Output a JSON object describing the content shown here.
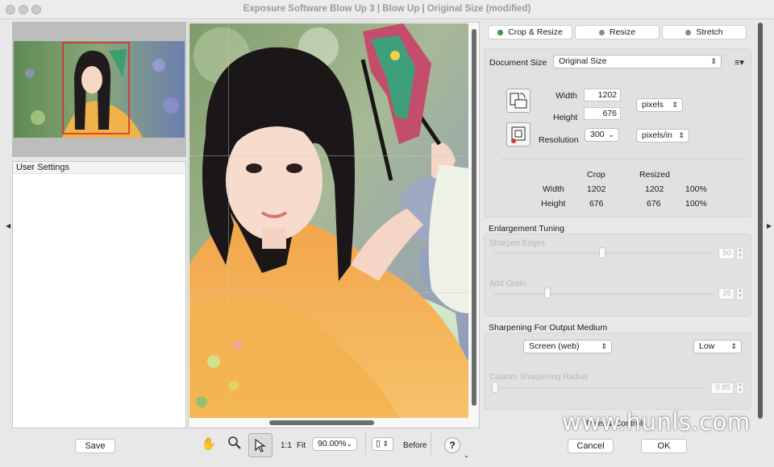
{
  "window": {
    "title": "Exposure Software Blow Up 3 | Blow Up | Original Size (modified)"
  },
  "left_panel": {
    "settings_header": "User Settings",
    "save_label": "Save"
  },
  "tabs": [
    {
      "label": "Crop & Resize",
      "icon": "green-dot-icon",
      "color": "#3ba44a"
    },
    {
      "label": "Resize",
      "icon": "gray-dot-icon",
      "color": "#8a8a8a"
    },
    {
      "label": "Stretch",
      "icon": "gray-dot-icon",
      "color": "#8a8a8a"
    }
  ],
  "document_size": {
    "label": "Document Size",
    "preset": "Original Size",
    "width_label": "Width",
    "width": "1202",
    "height_label": "Height",
    "height": "676",
    "unit": "pixels",
    "resolution_label": "Resolution",
    "resolution": "300",
    "resolution_unit": "pixels/in"
  },
  "summary": {
    "crop_header": "Crop",
    "resized_header": "Resized",
    "rows": [
      {
        "label": "Width",
        "crop": "1202",
        "resized": "1202",
        "pct": "100%"
      },
      {
        "label": "Height",
        "crop": "676",
        "resized": "676",
        "pct": "100%"
      }
    ]
  },
  "enlargement": {
    "title": "Enlargement Tuning",
    "sharpen_label": "Sharpen Edges",
    "sharpen_value": "50",
    "sharpen_level": 0.5,
    "grain_label": "Add Grain",
    "grain_value": "25",
    "grain_level": 0.25
  },
  "sharpening": {
    "title": "Sharpening For Output Medium",
    "medium": "Screen (web)",
    "strength": "Low",
    "radius_label": "Custom Sharpening Radius",
    "radius_value": "0.85"
  },
  "pixel_label": "Pixel & Controls",
  "bottom": {
    "ratio": "1:1",
    "fit": "Fit",
    "zoom": "90.00%",
    "before": "Before",
    "help": "?",
    "cancel": "Cancel",
    "ok": "OK"
  },
  "watermark": "www.hunls.com"
}
